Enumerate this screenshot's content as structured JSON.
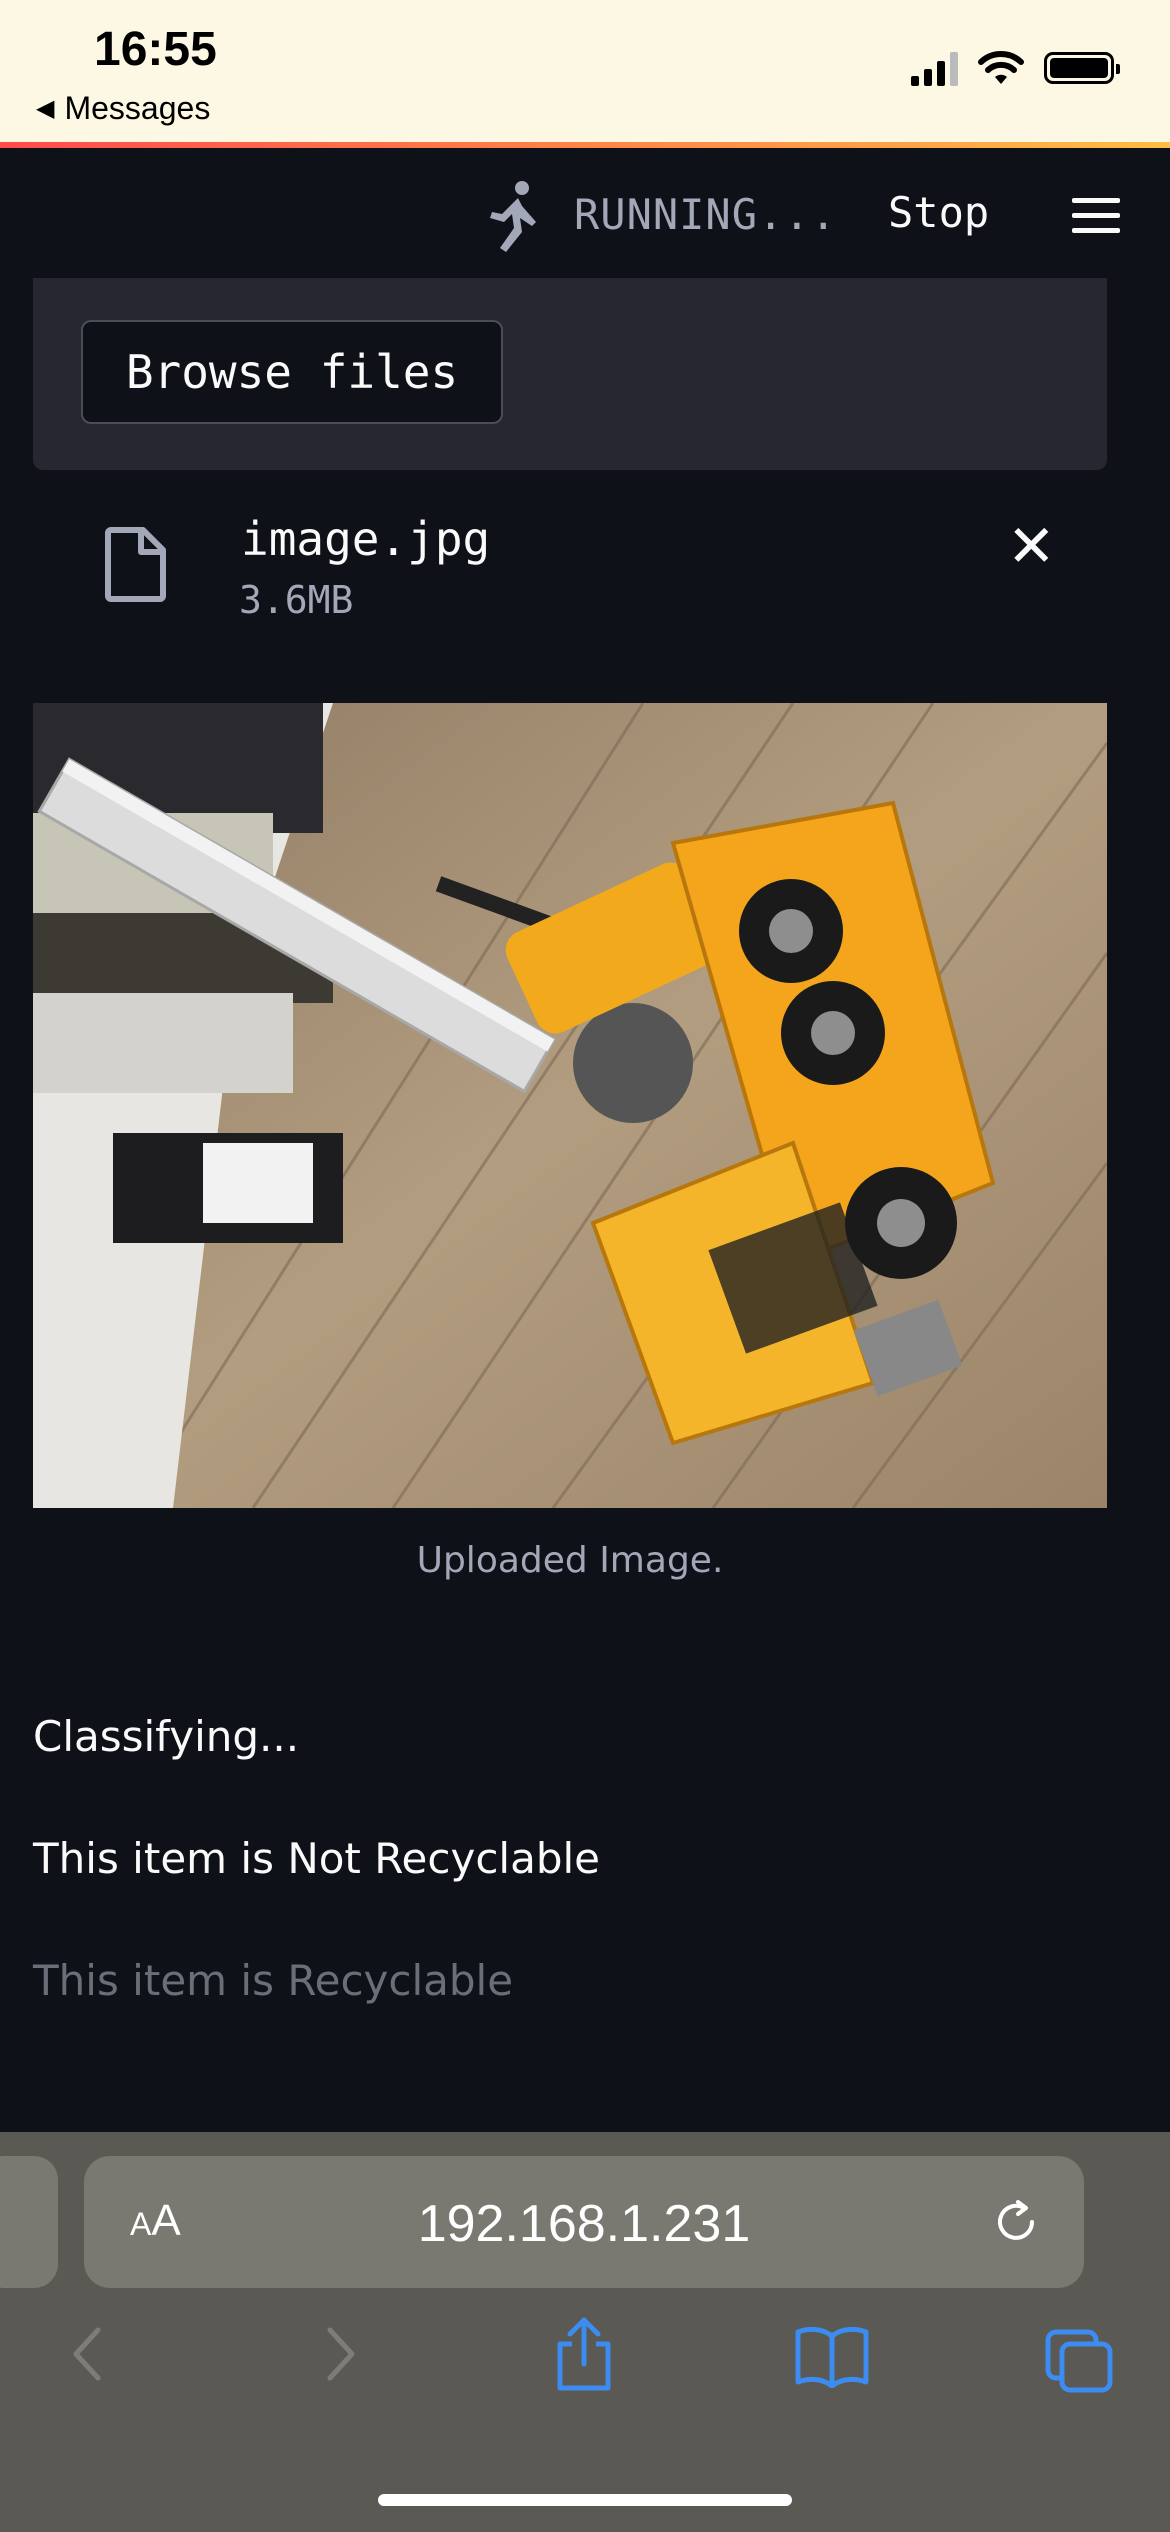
{
  "status_bar": {
    "time": "16:55",
    "back_label": "Messages"
  },
  "app": {
    "status_text": "RUNNING...",
    "stop_label": "Stop",
    "menu_icon": "hamburger-menu-icon",
    "accent_color": "#ff4b4b"
  },
  "uploader": {
    "browse_label": "Browse files",
    "file": {
      "name": "image.jpg",
      "size": "3.6MB"
    }
  },
  "image": {
    "caption": "Uploaded Image."
  },
  "results": {
    "line1": "Classifying...",
    "line2": "This item is Not Recyclable",
    "line3": "This item is Recyclable"
  },
  "browser": {
    "text_size_label": "AA",
    "url": "192.168.1.231"
  }
}
